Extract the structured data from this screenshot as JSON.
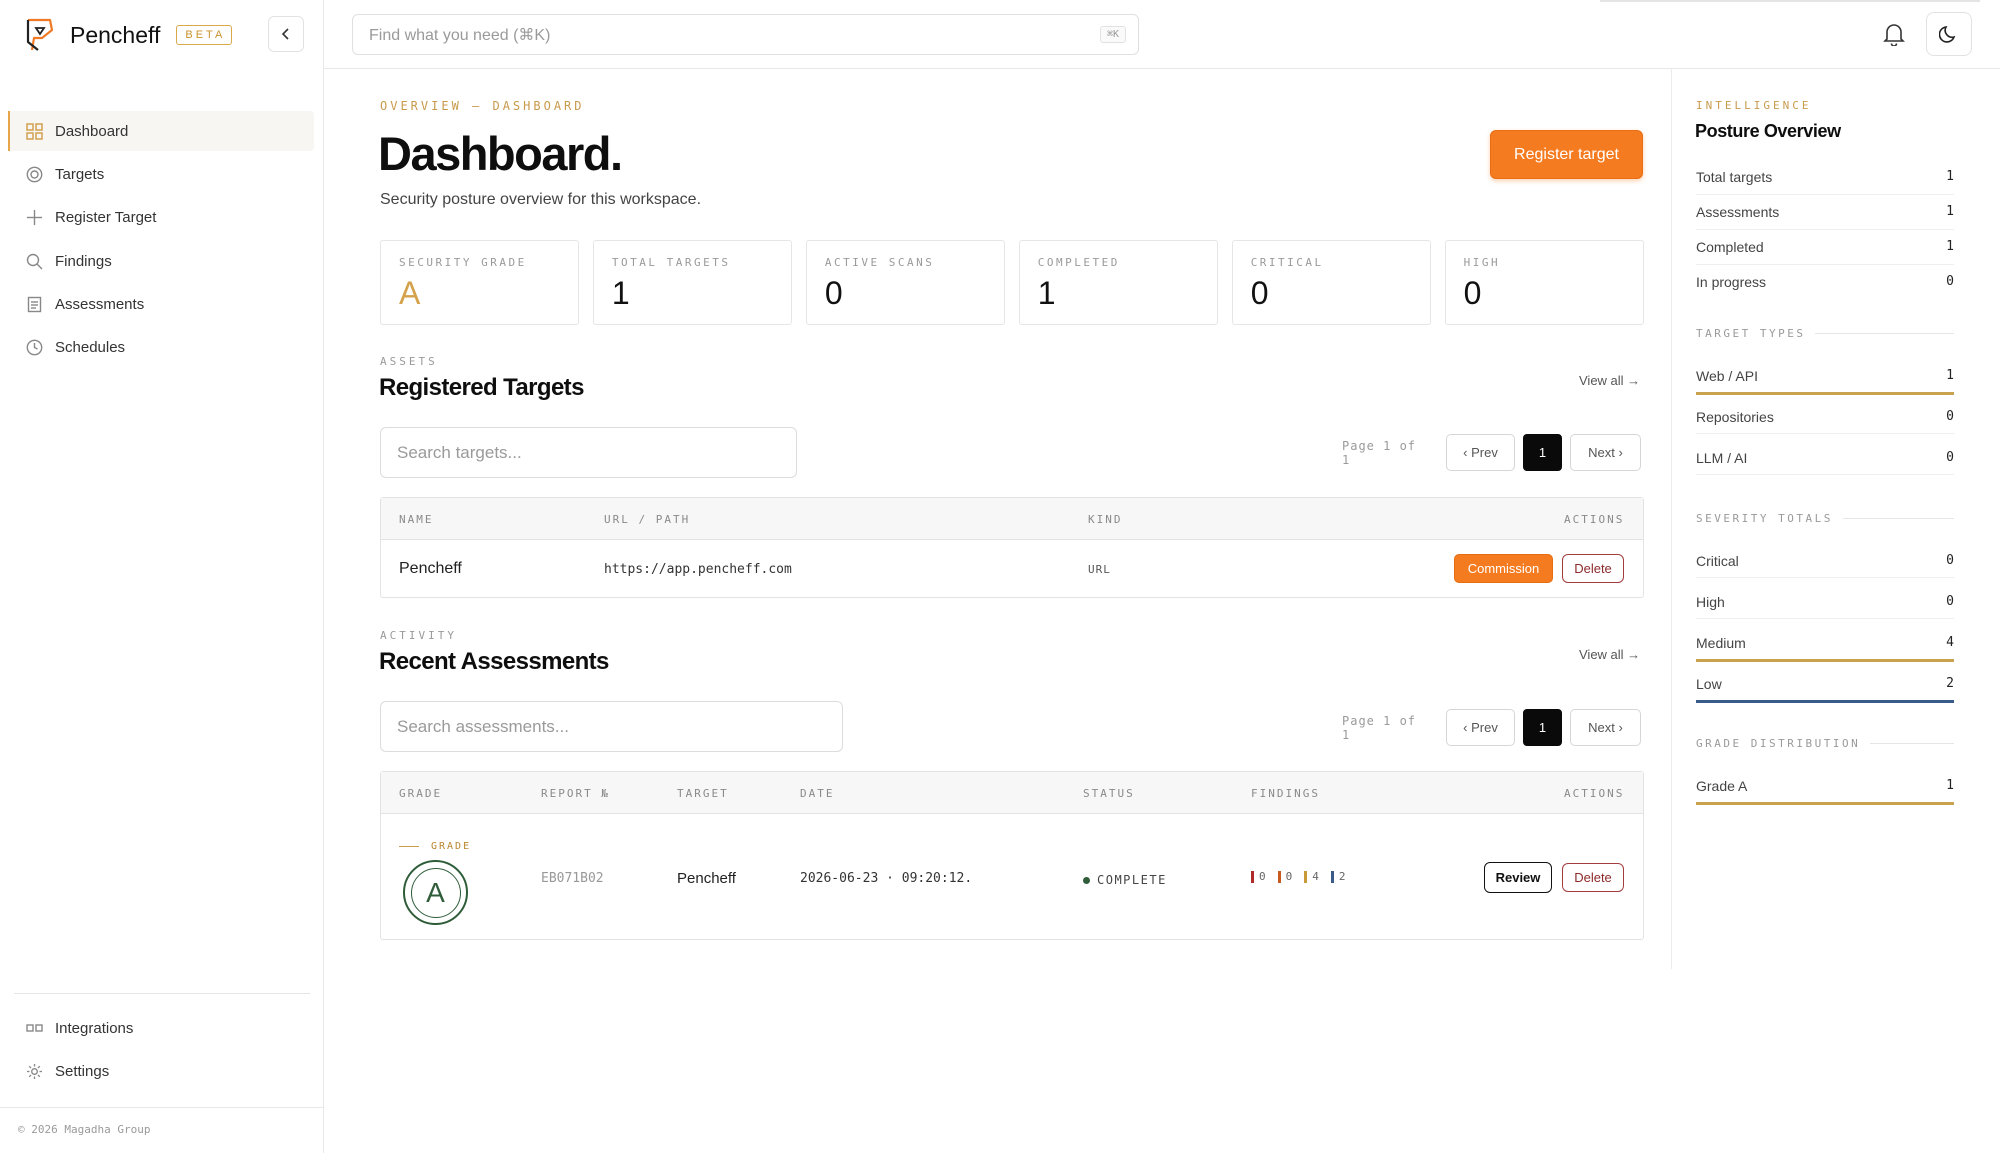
{
  "brand": {
    "name": "Pencheff",
    "badge": "BETA"
  },
  "sidebar": {
    "items": [
      {
        "label": "Dashboard",
        "icon": "grid-icon",
        "active": true
      },
      {
        "label": "Targets",
        "icon": "target-icon"
      },
      {
        "label": "Register Target",
        "icon": "plus-icon"
      },
      {
        "label": "Findings",
        "icon": "search-icon"
      },
      {
        "label": "Assessments",
        "icon": "clipboard-icon"
      },
      {
        "label": "Schedules",
        "icon": "clock-icon"
      }
    ],
    "bottom_items": [
      {
        "label": "Integrations",
        "icon": "integrations-icon"
      },
      {
        "label": "Settings",
        "icon": "gear-icon"
      }
    ],
    "copyright": "© 2026 Magadha Group"
  },
  "topbar": {
    "search_placeholder": "Find what you need  (⌘K)",
    "shortcut": "⌘K"
  },
  "page": {
    "eyebrow": "OVERVIEW — DASHBOARD",
    "title": "Dashboard.",
    "subtitle": "Security posture overview for this workspace.",
    "register_button": "Register target"
  },
  "stats": [
    {
      "label": "SECURITY GRADE",
      "value": "A"
    },
    {
      "label": "TOTAL TARGETS",
      "value": "1"
    },
    {
      "label": "ACTIVE SCANS",
      "value": "0"
    },
    {
      "label": "COMPLETED",
      "value": "1"
    },
    {
      "label": "CRITICAL",
      "value": "0"
    },
    {
      "label": "HIGH",
      "value": "0"
    }
  ],
  "targets": {
    "eyebrow": "ASSETS",
    "title": "Registered Targets",
    "view_all": "View all →",
    "search_placeholder": "Search targets...",
    "pager": {
      "info": "Page 1 of 1",
      "prev": "‹ Prev",
      "current": "1",
      "next": "Next ›"
    },
    "columns": [
      "NAME",
      "URL / PATH",
      "KIND",
      "ACTIONS"
    ],
    "rows": [
      {
        "name": "Pencheff",
        "url": "https://app.pencheff.com",
        "kind": "URL",
        "commission": "Commission",
        "delete": "Delete"
      }
    ]
  },
  "assessments": {
    "eyebrow": "ACTIVITY",
    "title": "Recent Assessments",
    "view_all": "View all →",
    "search_placeholder": "Search assessments...",
    "pager": {
      "info": "Page 1 of 1",
      "prev": "‹ Prev",
      "current": "1",
      "next": "Next ›"
    },
    "columns": [
      "GRADE",
      "REPORT №",
      "TARGET",
      "DATE",
      "STATUS",
      "FINDINGS",
      "ACTIONS"
    ],
    "rows": [
      {
        "grade_label": "GRADE",
        "grade": "A",
        "report": "EB071B02",
        "target": "Pencheff",
        "date": "2026-06-23 · 09:20:12.",
        "status": "COMPLETE",
        "findings": [
          "0",
          "0",
          "4",
          "2"
        ],
        "review": "Review",
        "delete": "Delete"
      }
    ]
  },
  "panel": {
    "eyebrow": "INTELLIGENCE",
    "title": "Posture Overview",
    "overview": [
      {
        "label": "Total targets",
        "value": "1"
      },
      {
        "label": "Assessments",
        "value": "1"
      },
      {
        "label": "Completed",
        "value": "1"
      },
      {
        "label": "In progress",
        "value": "0"
      }
    ],
    "target_types_title": "TARGET TYPES",
    "target_types": [
      {
        "label": "Web / API",
        "value": "1"
      },
      {
        "label": "Repositories",
        "value": "0"
      },
      {
        "label": "LLM / AI",
        "value": "0"
      }
    ],
    "severity_title": "SEVERITY TOTALS",
    "severity": [
      {
        "label": "Critical",
        "value": "0"
      },
      {
        "label": "High",
        "value": "0"
      },
      {
        "label": "Medium",
        "value": "4"
      },
      {
        "label": "Low",
        "value": "2"
      }
    ],
    "grade_title": "GRADE DISTRIBUTION",
    "grades": [
      {
        "label": "Grade A",
        "value": "1"
      }
    ]
  },
  "colors": {
    "accent": "#f57b20",
    "gold": "#c89a4c",
    "critical": "#b02a2a",
    "high": "#c75a1f",
    "medium": "#c89a3a",
    "low": "#3b5b8a",
    "grade_green": "#2f5d3a"
  }
}
